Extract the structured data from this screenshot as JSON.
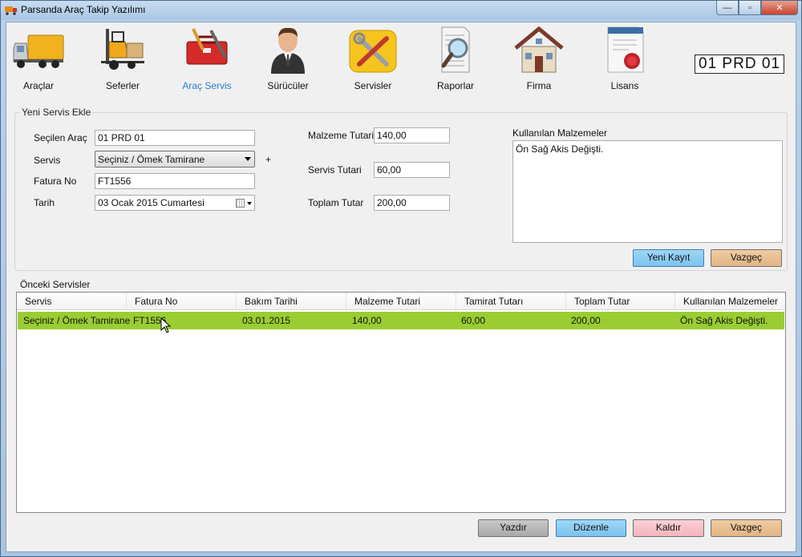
{
  "window": {
    "title": "Parsanda Araç Takip Yazılımı",
    "buttons": {
      "minimize": "—",
      "maximize": "▫",
      "close": "✕"
    }
  },
  "toolbar": {
    "items": [
      {
        "label": "Araçlar",
        "icon": "truck-icon"
      },
      {
        "label": "Seferler",
        "icon": "forklift-icon"
      },
      {
        "label": "Araç Servis",
        "icon": "toolbox-icon",
        "active": true
      },
      {
        "label": "Sürücüler",
        "icon": "driver-icon"
      },
      {
        "label": "Servisler",
        "icon": "tools-icon"
      },
      {
        "label": "Raporlar",
        "icon": "report-search-icon"
      },
      {
        "label": "Firma",
        "icon": "house-icon"
      },
      {
        "label": "Lisans",
        "icon": "certificate-icon"
      }
    ],
    "plate": "01 PRD 01"
  },
  "new_service": {
    "legend": "Yeni Servis Ekle",
    "selected_vehicle_label": "Seçilen Araç",
    "selected_vehicle_value": "01 PRD 01",
    "service_label": "Servis",
    "service_value": "Seçiniz / Ömek Tamirane",
    "plus": "+",
    "invoice_label": "Fatura No",
    "invoice_value": "FT1556",
    "date_label": "Tarih",
    "date_value": "03   Ocak   2015 Cumartesi",
    "material_cost_label": "Malzeme Tutari",
    "material_cost_value": "140,00",
    "service_cost_label": "Servis Tutari",
    "service_cost_value": "60,00",
    "total_label": "Toplam Tutar",
    "total_value": "200,00",
    "materials_label": "Kullanılan Malzemeler",
    "materials_value": "Ön Sağ Akis Değişti.",
    "new_record_button": "Yeni Kayıt",
    "cancel_button": "Vazgeç"
  },
  "previous_services": {
    "legend": "Önceki Servisler",
    "columns": [
      "Servis",
      "Fatura No",
      "Bakım Tarihi",
      "Malzeme Tutari",
      "Tamirat Tutarı",
      "Toplam Tutar",
      "Kullanılan Malzemeler"
    ],
    "rows": [
      [
        "Seçiniz / Ömek Tamirane",
        "FT1556",
        "03.01.2015",
        "140,00",
        "60,00",
        "200,00",
        "Ön Sağ Akis Değişti."
      ]
    ],
    "selected_row_color": "#9acd32"
  },
  "footer_buttons": {
    "print": "Yazdır",
    "edit": "Düzenle",
    "remove": "Kaldır",
    "cancel": "Vazgeç"
  }
}
